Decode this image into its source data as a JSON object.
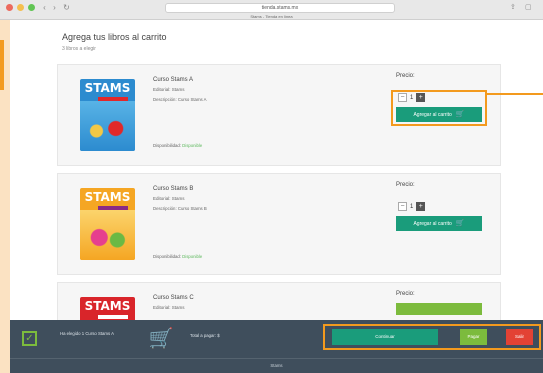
{
  "browser": {
    "url": "tienda.stams.mx",
    "tab_title": "Stams - Tienda en línea",
    "back_icon": "back-arrow-icon",
    "forward_icon": "forward-arrow-icon",
    "reload_icon": "reload-icon"
  },
  "page": {
    "heading": "Agrega tus libros al carrito",
    "subheading": "3 libros a elegir"
  },
  "books": [
    {
      "cover_brand": "STAMS",
      "title": "Curso Stams A",
      "publisher": "Editorial: Stams",
      "description": "Descripción: Curso Stams A",
      "availability_label": "Disponibilidad:",
      "availability_value": "Disponible",
      "price_label": "Precio:",
      "price_note": "",
      "quantity": "1",
      "add_button": "Agregar al carrito"
    },
    {
      "cover_brand": "STAMS",
      "title": "Curso Stams B",
      "publisher": "Editorial: Stams",
      "description": "Descripción: Curso Stams B",
      "availability_label": "Disponibilidad:",
      "availability_value": "Disponible",
      "price_label": "Precio:",
      "price_note": "",
      "quantity": "1",
      "add_button": "Agregar al carrito"
    },
    {
      "cover_brand": "STAMS",
      "title": "Curso Stams C",
      "publisher": "Editorial: Stams",
      "price_label": "Precio:",
      "price_note": ""
    }
  ],
  "bottom_bar": {
    "selected_text": "Ha elegido 1 Curso Stams A",
    "total_text": "Total a pagar: $",
    "continue_button": "Continuar",
    "pay_button": "Pagar",
    "exit_button": "Salir"
  },
  "footer": {
    "text": "Stams"
  },
  "colors": {
    "accent_orange": "#f39a1e",
    "primary_green": "#1a9c7b",
    "light_green": "#7cbb3d",
    "danger_red": "#e34234",
    "bar_dark": "#3f4e5c"
  }
}
